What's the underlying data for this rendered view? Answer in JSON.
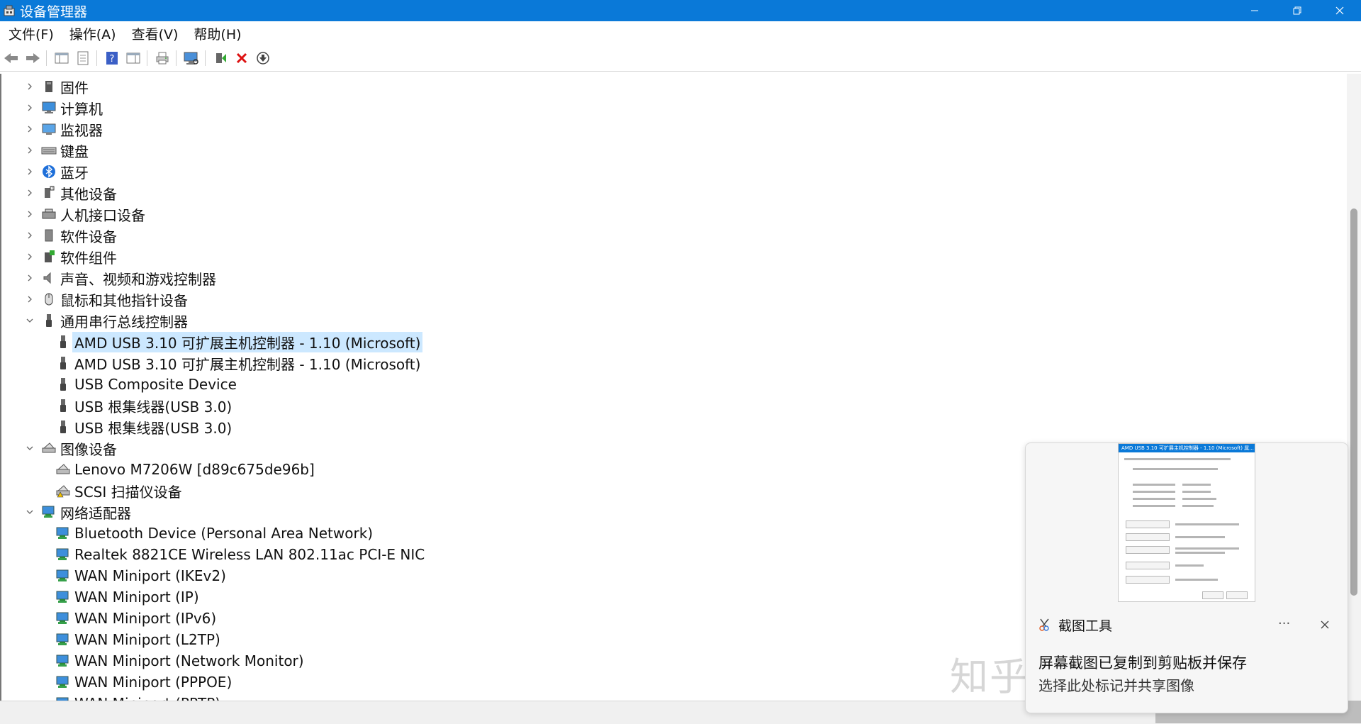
{
  "window": {
    "title": "设备管理器"
  },
  "menu": [
    "文件(F)",
    "操作(A)",
    "查看(V)",
    "帮助(H)"
  ],
  "toolbar_icons": [
    "back-arrow-icon",
    "forward-arrow-icon",
    "show-hide-console-tree-icon",
    "properties-icon",
    "help-icon",
    "show-action-pane-icon",
    "print-icon",
    "scan-hardware-changes-icon",
    "update-driver-icon",
    "uninstall-device-icon",
    "disable-device-icon"
  ],
  "tree": [
    {
      "label": "固件",
      "expanded": false,
      "icon": "firmware-icon"
    },
    {
      "label": "计算机",
      "expanded": false,
      "icon": "computer-icon"
    },
    {
      "label": "监视器",
      "expanded": false,
      "icon": "monitor-icon"
    },
    {
      "label": "键盘",
      "expanded": false,
      "icon": "keyboard-icon"
    },
    {
      "label": "蓝牙",
      "expanded": false,
      "icon": "bluetooth-icon"
    },
    {
      "label": "其他设备",
      "expanded": false,
      "icon": "other-devices-icon"
    },
    {
      "label": "人机接口设备",
      "expanded": false,
      "icon": "hid-icon"
    },
    {
      "label": "软件设备",
      "expanded": false,
      "icon": "software-device-icon"
    },
    {
      "label": "软件组件",
      "expanded": false,
      "icon": "software-component-icon"
    },
    {
      "label": "声音、视频和游戏控制器",
      "expanded": false,
      "icon": "speaker-icon"
    },
    {
      "label": "鼠标和其他指针设备",
      "expanded": false,
      "icon": "mouse-icon"
    },
    {
      "label": "通用串行总线控制器",
      "expanded": true,
      "icon": "usb-icon",
      "children": [
        {
          "label": "AMD USB 3.10 可扩展主机控制器 - 1.10 (Microsoft)",
          "selected": true,
          "icon": "usb-icon"
        },
        {
          "label": "AMD USB 3.10 可扩展主机控制器 - 1.10 (Microsoft)",
          "icon": "usb-icon"
        },
        {
          "label": "USB Composite Device",
          "icon": "usb-icon"
        },
        {
          "label": "USB 根集线器(USB 3.0)",
          "icon": "usb-icon"
        },
        {
          "label": "USB 根集线器(USB 3.0)",
          "icon": "usb-icon"
        }
      ]
    },
    {
      "label": "图像设备",
      "expanded": true,
      "icon": "imaging-device-icon",
      "children": [
        {
          "label": "Lenovo M7206W [d89c675de96b]",
          "icon": "scanner-icon"
        },
        {
          "label": "SCSI 扫描仪设备",
          "icon": "scanner-warning-icon"
        }
      ]
    },
    {
      "label": "网络适配器",
      "expanded": true,
      "icon": "network-adapter-icon",
      "children": [
        {
          "label": "Bluetooth Device (Personal Area Network)",
          "icon": "network-adapter-icon"
        },
        {
          "label": "Realtek 8821CE Wireless LAN 802.11ac PCI-E NIC",
          "icon": "network-adapter-icon"
        },
        {
          "label": "WAN Miniport (IKEv2)",
          "icon": "network-adapter-icon"
        },
        {
          "label": "WAN Miniport (IP)",
          "icon": "network-adapter-icon"
        },
        {
          "label": "WAN Miniport (IPv6)",
          "icon": "network-adapter-icon"
        },
        {
          "label": "WAN Miniport (L2TP)",
          "icon": "network-adapter-icon"
        },
        {
          "label": "WAN Miniport (Network Monitor)",
          "icon": "network-adapter-icon"
        },
        {
          "label": "WAN Miniport (PPPOE)",
          "icon": "network-adapter-icon"
        },
        {
          "label": "WAN Miniport (PPTP)",
          "icon": "network-adapter-icon"
        }
      ]
    }
  ],
  "notification": {
    "app_name": "截图工具",
    "more": "···",
    "line1": "屏幕截图已复制到剪贴板并保存",
    "line2": "选择此处标记并共享图像",
    "thumbnail_title": "AMD USB 3.10 可扩展主机控制器 - 1.10 (Microsoft) 属..."
  },
  "watermark": "知乎 @Flentmmmm",
  "colors": {
    "accent": "#0a79d8",
    "selection": "#cce8ff"
  }
}
